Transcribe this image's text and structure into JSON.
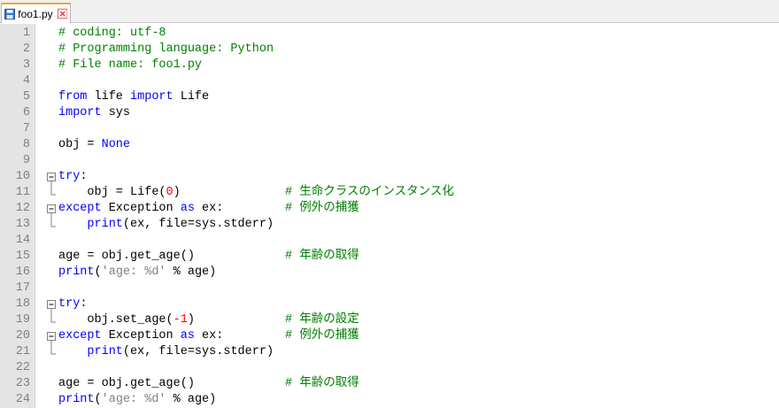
{
  "tab": {
    "filename": "foo1.py"
  },
  "lines": [
    {
      "num": "1",
      "code": [
        {
          "t": "# coding: utf-8",
          "c": "comment"
        }
      ]
    },
    {
      "num": "2",
      "code": [
        {
          "t": "# Programming language: Python",
          "c": "comment"
        }
      ]
    },
    {
      "num": "3",
      "code": [
        {
          "t": "# File name: foo1.py",
          "c": "comment"
        }
      ]
    },
    {
      "num": "4",
      "code": []
    },
    {
      "num": "5",
      "code": [
        {
          "t": "from",
          "c": "kw"
        },
        {
          "t": " life ",
          "c": "txt"
        },
        {
          "t": "import",
          "c": "kw"
        },
        {
          "t": " Life",
          "c": "txt"
        }
      ]
    },
    {
      "num": "6",
      "code": [
        {
          "t": "import",
          "c": "kw"
        },
        {
          "t": " sys",
          "c": "txt"
        }
      ]
    },
    {
      "num": "7",
      "code": []
    },
    {
      "num": "8",
      "code": [
        {
          "t": "obj = ",
          "c": "txt"
        },
        {
          "t": "None",
          "c": "kw"
        }
      ]
    },
    {
      "num": "9",
      "code": []
    },
    {
      "num": "10",
      "fold": "open",
      "code": [
        {
          "t": "try",
          "c": "kw"
        },
        {
          "t": ":",
          "c": "txt"
        }
      ]
    },
    {
      "num": "11",
      "fold": "end",
      "code": [
        {
          "t": "    obj = Life(",
          "c": "txt"
        },
        {
          "t": "0",
          "c": "num"
        },
        {
          "t": ")",
          "c": "txt"
        }
      ],
      "comment": "# 生命クラスのインスタンス化"
    },
    {
      "num": "12",
      "fold": "open",
      "code": [
        {
          "t": "except",
          "c": "kw"
        },
        {
          "t": " Exception ",
          "c": "txt"
        },
        {
          "t": "as",
          "c": "kw"
        },
        {
          "t": " ex:",
          "c": "txt"
        }
      ],
      "comment": "# 例外の捕獲"
    },
    {
      "num": "13",
      "fold": "end",
      "code": [
        {
          "t": "    ",
          "c": "txt"
        },
        {
          "t": "print",
          "c": "kw"
        },
        {
          "t": "(ex, file=sys.stderr)",
          "c": "txt"
        }
      ]
    },
    {
      "num": "14",
      "code": []
    },
    {
      "num": "15",
      "code": [
        {
          "t": "age = obj.get_age()",
          "c": "txt"
        }
      ],
      "comment": "# 年齢の取得"
    },
    {
      "num": "16",
      "code": [
        {
          "t": "print",
          "c": "kw"
        },
        {
          "t": "(",
          "c": "txt"
        },
        {
          "t": "'age: %d'",
          "c": "str"
        },
        {
          "t": " % age)",
          "c": "txt"
        }
      ]
    },
    {
      "num": "17",
      "code": []
    },
    {
      "num": "18",
      "fold": "open",
      "code": [
        {
          "t": "try",
          "c": "kw"
        },
        {
          "t": ":",
          "c": "txt"
        }
      ]
    },
    {
      "num": "19",
      "fold": "end",
      "code": [
        {
          "t": "    obj.set_age(",
          "c": "txt"
        },
        {
          "t": "-1",
          "c": "num"
        },
        {
          "t": ")",
          "c": "txt"
        }
      ],
      "comment": "# 年齢の設定"
    },
    {
      "num": "20",
      "fold": "open",
      "code": [
        {
          "t": "except",
          "c": "kw"
        },
        {
          "t": " Exception ",
          "c": "txt"
        },
        {
          "t": "as",
          "c": "kw"
        },
        {
          "t": " ex:",
          "c": "txt"
        }
      ],
      "comment": "# 例外の捕獲"
    },
    {
      "num": "21",
      "fold": "end",
      "code": [
        {
          "t": "    ",
          "c": "txt"
        },
        {
          "t": "print",
          "c": "kw"
        },
        {
          "t": "(ex, file=sys.stderr)",
          "c": "txt"
        }
      ]
    },
    {
      "num": "22",
      "code": []
    },
    {
      "num": "23",
      "code": [
        {
          "t": "age = obj.get_age()",
          "c": "txt"
        }
      ],
      "comment": "# 年齢の取得"
    },
    {
      "num": "24",
      "code": [
        {
          "t": "print",
          "c": "kw"
        },
        {
          "t": "(",
          "c": "txt"
        },
        {
          "t": "'age: %d'",
          "c": "str"
        },
        {
          "t": " % age)",
          "c": "txt"
        }
      ]
    }
  ],
  "colors": {
    "comment": "#008000",
    "keyword": "#0000ff",
    "number": "#ff0000",
    "string": "#808080",
    "line_number": "#808080",
    "tab_accent": "#f3a43d",
    "close_icon": "#e04343",
    "save_icon": "#2f6fc4"
  },
  "icons": {
    "tab_file": "floppy-disk-icon",
    "tab_close": "close-icon",
    "fold_open": "fold-minus-icon",
    "fold_end": "fold-end-icon"
  }
}
